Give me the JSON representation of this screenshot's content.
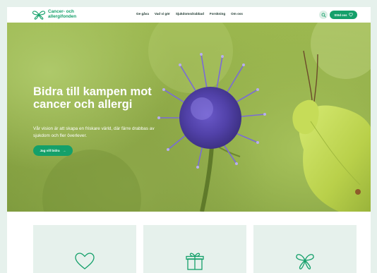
{
  "logo": {
    "line1": "Cancer- och",
    "line2": "allergifonden"
  },
  "nav": {
    "items": [
      "Ge gåva",
      "Vad vi gör",
      "Sjukdomsdrabbad",
      "Forskning",
      "Om oss"
    ]
  },
  "header": {
    "support_label": "Stöd oss"
  },
  "hero": {
    "title": "Bidra till kampen mot cancer och allergi",
    "subtitle": "Vår vision är att skapa en friskare värld, där färre drabbas av sjukdom och fler överlever.",
    "cta_label": "Jag vill bidra",
    "cta_arrow": "→"
  },
  "cards": [
    {
      "icon": "heart-icon"
    },
    {
      "icon": "gift-icon"
    },
    {
      "icon": "butterfly-icon"
    }
  ],
  "colors": {
    "brand": "#14a06a",
    "background": "#e6f1ec",
    "nav_text": "#17332a"
  }
}
